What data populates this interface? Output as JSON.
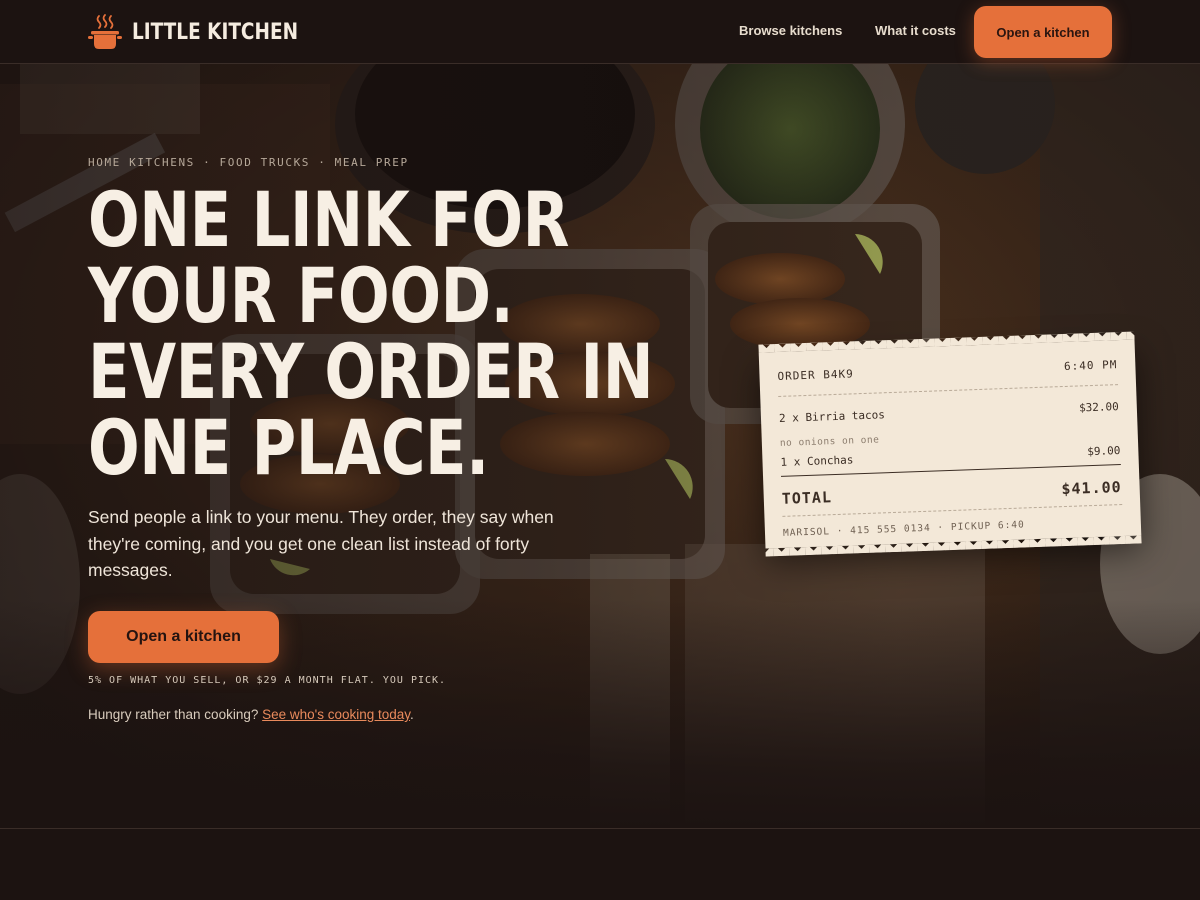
{
  "brand": {
    "name": "LITTLE KITCHEN",
    "logo_icon": "cooking-pot-icon"
  },
  "nav": {
    "links": [
      "Browse kitchens",
      "What it costs"
    ],
    "cta_label": "Open a kitchen"
  },
  "hero": {
    "eyebrow": "HOME KITCHENS · FOOD TRUCKS · MEAL PREP",
    "headline_lines": [
      "ONE LINK FOR",
      "YOUR FOOD.",
      "EVERY ORDER IN",
      "ONE PLACE."
    ],
    "subcopy": "Send people a link to your menu. They order, they say when they're coming, and you get one clean list instead of forty messages.",
    "cta_label": "Open a kitchen",
    "pricing_note": "5% OF WHAT YOU SELL, OR $29 A MONTH FLAT. YOU PICK.",
    "hungry_prefix": "Hungry rather than cooking?",
    "hungry_link": "See who's cooking today",
    "hungry_suffix": "."
  },
  "receipt": {
    "order_label": "ORDER B4K9",
    "time": "6:40 PM",
    "items": [
      {
        "name": "2 x Birria tacos",
        "price": "$32.00",
        "note": "no onions on one"
      },
      {
        "name": "1 x Conchas",
        "price": "$9.00",
        "note": ""
      }
    ],
    "total_label": "TOTAL",
    "total_value": "$41.00",
    "footer": "MARISOL · 415 555 0134 · PICKUP 6:40"
  },
  "colors": {
    "background": "#1c1311",
    "accent": "#e5703a",
    "text": "#f3e9dc",
    "receipt_paper": "#f3e8d8"
  }
}
